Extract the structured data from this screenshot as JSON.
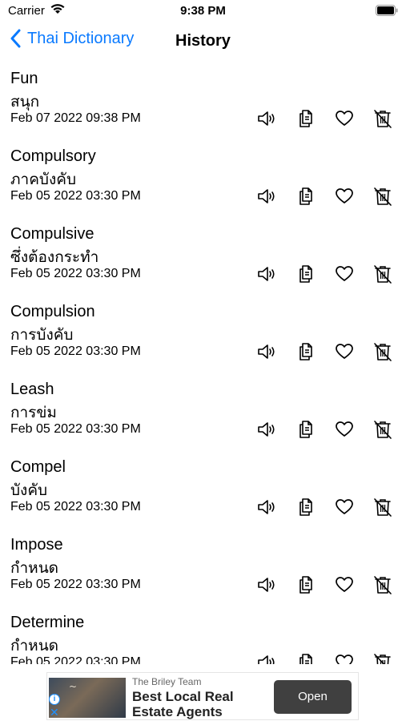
{
  "status_bar": {
    "carrier": "Carrier",
    "time": "9:38 PM"
  },
  "nav": {
    "back_label": "Thai Dictionary",
    "title": "History"
  },
  "colors": {
    "accent": "#0a7aff"
  },
  "icons": {
    "speaker": "speaker-icon",
    "copy": "copy-icon",
    "favorite": "heart-icon",
    "delete": "trash-icon"
  },
  "history": [
    {
      "word": "Fun",
      "thai": "สนุก",
      "date": "Feb 07 2022 09:38 PM"
    },
    {
      "word": "Compulsory",
      "thai": "ภาคบังคับ",
      "date": "Feb 05 2022 03:30 PM"
    },
    {
      "word": "Compulsive",
      "thai": "ซึ่งต้องกระทำ",
      "date": "Feb 05 2022 03:30 PM"
    },
    {
      "word": "Compulsion",
      "thai": "การบังคับ",
      "date": "Feb 05 2022 03:30 PM"
    },
    {
      "word": "Leash",
      "thai": "การข่ม",
      "date": "Feb 05 2022 03:30 PM"
    },
    {
      "word": "Compel",
      "thai": "บังคับ",
      "date": "Feb 05 2022 03:30 PM"
    },
    {
      "word": "Impose",
      "thai": "กำหนด",
      "date": "Feb 05 2022 03:30 PM"
    },
    {
      "word": "Determine",
      "thai": "กำหนด",
      "date": "Feb 05 2022 03:30 PM"
    }
  ],
  "ad": {
    "sponsor": "The Briley Team",
    "headline": "Best Local Real Estate Agents",
    "button": "Open"
  }
}
